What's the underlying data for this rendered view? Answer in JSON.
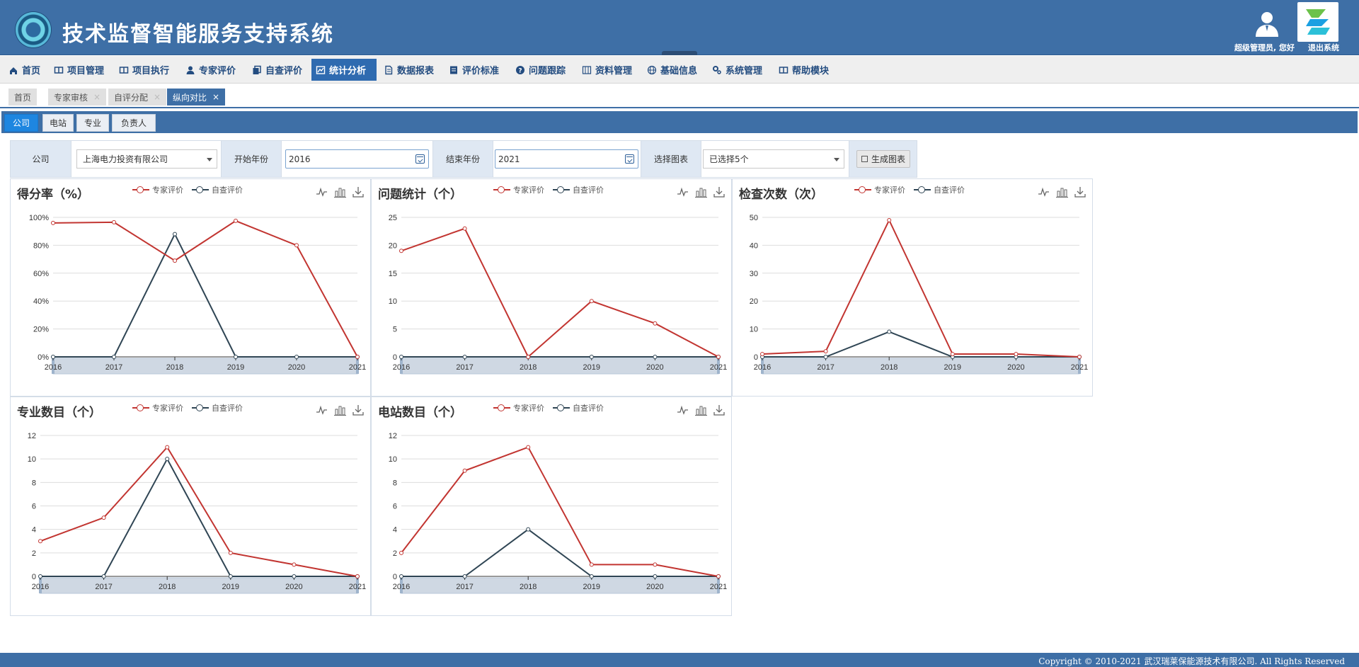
{
  "header": {
    "title": "技术监督智能服务支持系统",
    "user_greeting": "超级管理员, 您好",
    "exit_label": "退出系统"
  },
  "nav": [
    {
      "label": "首页",
      "icon": "home-icon"
    },
    {
      "label": "项目管理",
      "icon": "book-icon"
    },
    {
      "label": "项目执行",
      "icon": "book-icon"
    },
    {
      "label": "专家评价",
      "icon": "user-icon"
    },
    {
      "label": "自查评价",
      "icon": "copy-icon"
    },
    {
      "label": "统计分析",
      "icon": "chart-icon",
      "active": true
    },
    {
      "label": "数据报表",
      "icon": "file-icon"
    },
    {
      "label": "评价标准",
      "icon": "list-icon"
    },
    {
      "label": "问题跟踪",
      "icon": "question-icon"
    },
    {
      "label": "资料管理",
      "icon": "columns-icon"
    },
    {
      "label": "基础信息",
      "icon": "globe-icon"
    },
    {
      "label": "系统管理",
      "icon": "gears-icon"
    },
    {
      "label": "帮助模块",
      "icon": "book-icon"
    }
  ],
  "tabs": [
    {
      "label": "首页",
      "closable": false
    },
    {
      "label": "专家审核",
      "closable": true
    },
    {
      "label": "自评分配",
      "closable": true
    },
    {
      "label": "纵向对比",
      "closable": true,
      "active": true
    }
  ],
  "subtabs": [
    {
      "label": "公司",
      "active": true
    },
    {
      "label": "电站"
    },
    {
      "label": "专业"
    },
    {
      "label": "负责人"
    }
  ],
  "filter": {
    "company_label": "公司",
    "company_value": "上海电力投资有限公司",
    "start_label": "开始年份",
    "start_value": "2016",
    "end_label": "结束年份",
    "end_value": "2021",
    "chart_label": "选择图表",
    "chart_value": "已选择5个",
    "generate_label": "生成图表"
  },
  "colors": {
    "expert": "#c23531",
    "self": "#2f4554",
    "brand": "#3e6fa6"
  },
  "footer": {
    "copyright": "Copyright © 2010-2021 武汉瑞莱保能源技术有限公司. All Rights Reserved"
  },
  "chart_data": [
    {
      "type": "line",
      "title": "得分率（%）",
      "categories": [
        "2016",
        "2017",
        "2018",
        "2019",
        "2020",
        "2021"
      ],
      "ylim": [
        0,
        100
      ],
      "yticks": [
        "0%",
        "20%",
        "40%",
        "60%",
        "80%",
        "100%"
      ],
      "series": [
        {
          "name": "专家评价",
          "values": [
            96,
            96.5,
            69,
            97.5,
            80,
            0
          ]
        },
        {
          "name": "自查评价",
          "values": [
            0,
            0,
            88,
            0,
            0,
            0
          ]
        }
      ],
      "legend_position": "top-center"
    },
    {
      "type": "line",
      "title": "问题统计（个）",
      "categories": [
        "2016",
        "2017",
        "2018",
        "2019",
        "2020",
        "2021"
      ],
      "ylim": [
        0,
        25
      ],
      "yticks": [
        "0",
        "5",
        "10",
        "15",
        "20",
        "25"
      ],
      "series": [
        {
          "name": "专家评价",
          "values": [
            19,
            23,
            0,
            10,
            6,
            0
          ]
        },
        {
          "name": "自查评价",
          "values": [
            0,
            0,
            0,
            0,
            0,
            0
          ]
        }
      ],
      "legend_position": "top-center"
    },
    {
      "type": "line",
      "title": "检查次数（次）",
      "categories": [
        "2016",
        "2017",
        "2018",
        "2019",
        "2020",
        "2021"
      ],
      "ylim": [
        0,
        50
      ],
      "yticks": [
        "0",
        "10",
        "20",
        "30",
        "40",
        "50"
      ],
      "series": [
        {
          "name": "专家评价",
          "values": [
            1,
            2,
            49,
            1,
            1,
            0
          ]
        },
        {
          "name": "自查评价",
          "values": [
            0,
            0,
            9,
            0,
            0,
            0
          ]
        }
      ],
      "legend_position": "top-center"
    },
    {
      "type": "line",
      "title": "专业数目（个）",
      "categories": [
        "2016",
        "2017",
        "2018",
        "2019",
        "2020",
        "2021"
      ],
      "ylim": [
        0,
        12
      ],
      "yticks": [
        "0",
        "2",
        "4",
        "6",
        "8",
        "10",
        "12"
      ],
      "series": [
        {
          "name": "专家评价",
          "values": [
            3,
            5,
            11,
            2,
            1,
            0
          ]
        },
        {
          "name": "自查评价",
          "values": [
            0,
            0,
            10,
            0,
            0,
            0
          ]
        }
      ],
      "legend_position": "top-center"
    },
    {
      "type": "line",
      "title": "电站数目（个）",
      "categories": [
        "2016",
        "2017",
        "2018",
        "2019",
        "2020",
        "2021"
      ],
      "ylim": [
        0,
        12
      ],
      "yticks": [
        "0",
        "2",
        "4",
        "6",
        "8",
        "10",
        "12"
      ],
      "series": [
        {
          "name": "专家评价",
          "values": [
            2,
            9,
            11,
            1,
            1,
            0
          ]
        },
        {
          "name": "自查评价",
          "values": [
            0,
            0,
            4,
            0,
            0,
            0
          ]
        }
      ],
      "legend_position": "top-center"
    }
  ]
}
